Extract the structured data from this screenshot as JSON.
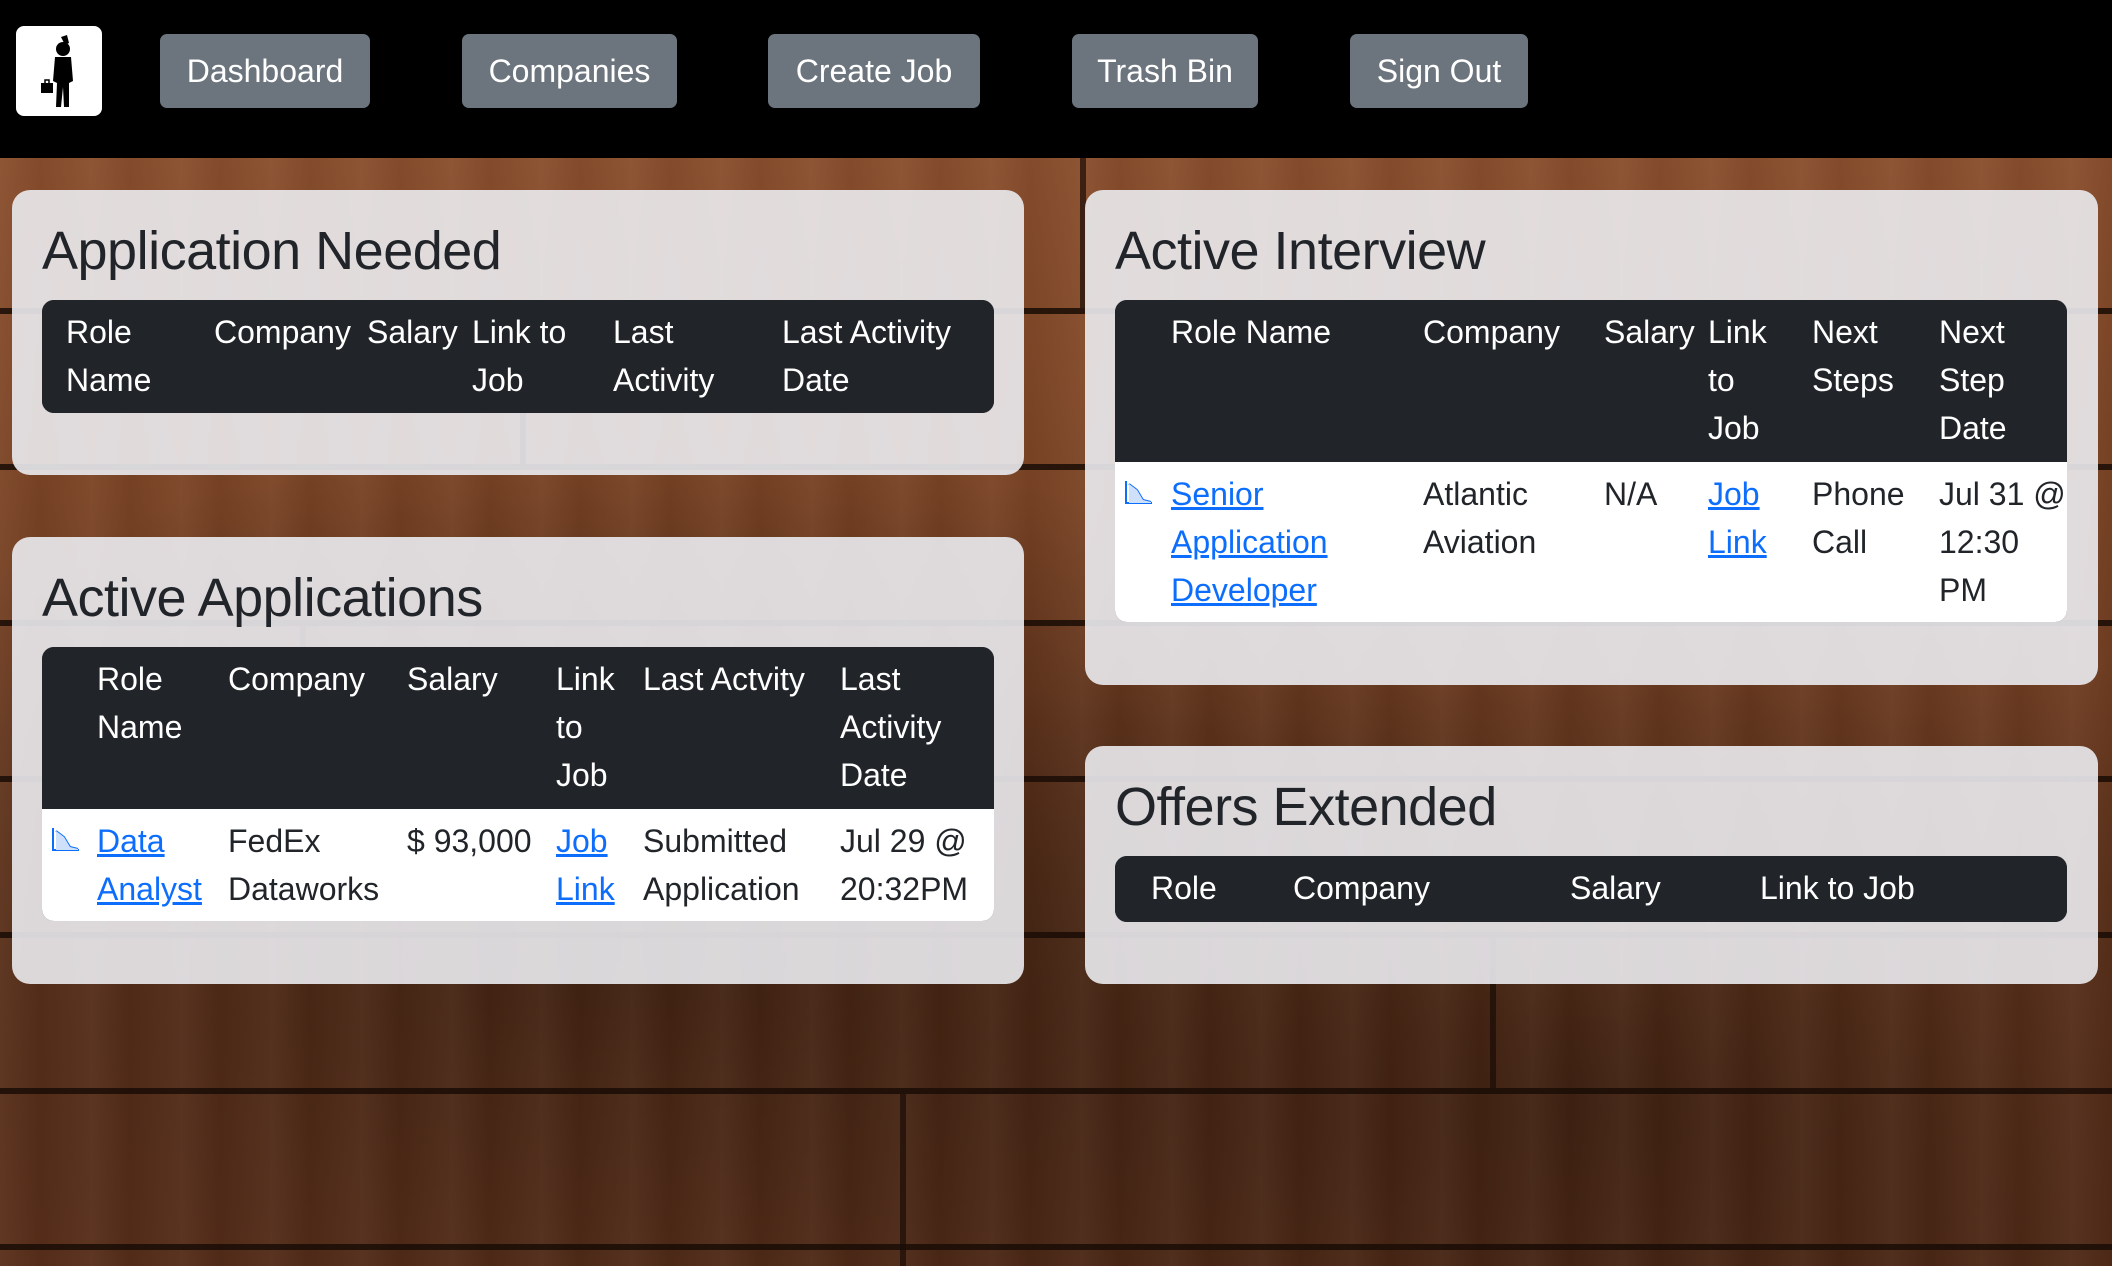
{
  "nav": {
    "logo": "businessman-logo",
    "buttons": [
      "Dashboard",
      "Companies",
      "Create Job",
      "Trash Bin",
      "Sign Out"
    ]
  },
  "application_needed": {
    "title": "Application Needed",
    "headers": [
      "Role Name",
      "Company",
      "Salary",
      "Link to Job",
      "Last Activity",
      "Last Activity Date"
    ]
  },
  "active_applications": {
    "title": "Active Applications",
    "headers": [
      "Role Name",
      "Company",
      "Salary",
      "Link to Job",
      "Last Actvity",
      "Last Activity Date"
    ],
    "rows": [
      {
        "role": "Data Analyst",
        "company": "FedEx Dataworks",
        "salary": "$ 93,000",
        "link": "Job Link",
        "last_activity": "Submitted Application",
        "date": "Jul 29 @ 20:32PM"
      }
    ]
  },
  "active_interview": {
    "title": "Active Interview",
    "headers": [
      "Role Name",
      "Company",
      "Salary",
      "Link to Job",
      "Next Steps",
      "Next Step Date"
    ],
    "rows": [
      {
        "role": "Senior Application Developer",
        "company": "Atlantic Aviation",
        "salary": "N/A",
        "link": "Job Link",
        "next_steps": "Phone Call",
        "date": "Jul 31 @ 12:30 PM"
      }
    ]
  },
  "offers_extended": {
    "title": "Offers Extended",
    "headers": [
      "Role",
      "Company",
      "Salary",
      "Link to Job"
    ]
  },
  "colors": {
    "navbar": "#000000",
    "nav_button": "#6c757d",
    "table_header": "#212529",
    "link": "#0d6efd"
  }
}
